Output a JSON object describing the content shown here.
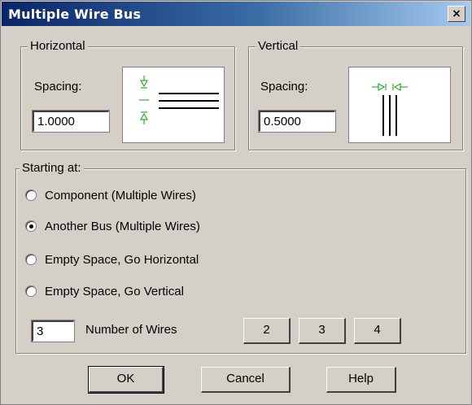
{
  "window": {
    "title": "Multiple Wire Bus",
    "close_label": "×"
  },
  "horizontal": {
    "legend": "Horizontal",
    "spacing_label": "Spacing:",
    "spacing_value": "1.0000"
  },
  "vertical": {
    "legend": "Vertical",
    "spacing_label": "Spacing:",
    "spacing_value": "0.5000"
  },
  "starting": {
    "legend": "Starting at:",
    "options": [
      {
        "label": "Component (Multiple Wires)",
        "checked": false
      },
      {
        "label": "Another Bus (Multiple Wires)",
        "checked": true
      },
      {
        "label": "Empty Space, Go Horizontal",
        "checked": false
      },
      {
        "label": "Empty Space, Go Vertical",
        "checked": false
      }
    ],
    "wires_value": "3",
    "wires_label": "Number of Wires",
    "quick_buttons": [
      "2",
      "3",
      "4"
    ]
  },
  "buttons": {
    "ok": "OK",
    "cancel": "Cancel",
    "help": "Help"
  },
  "colors": {
    "dimension_green": "#00a000",
    "title_start": "#0a246a",
    "title_end": "#a6caf0"
  }
}
